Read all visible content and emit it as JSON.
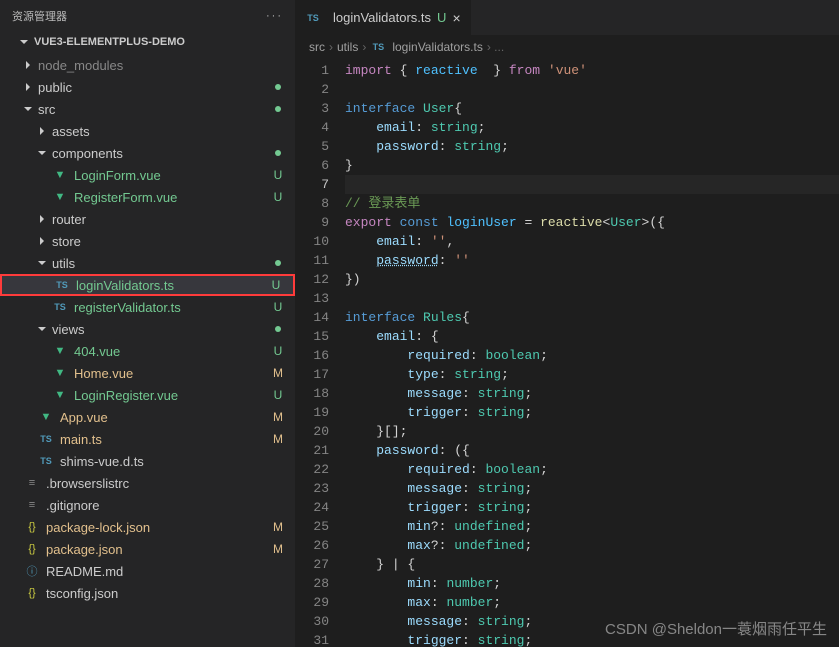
{
  "sidebar": {
    "title": "资源管理器",
    "project": "VUE3-ELEMENTPLUS-DEMO"
  },
  "tree": [
    {
      "name": "node_modules",
      "type": "folder",
      "expanded": false,
      "depth": 0,
      "dim": true
    },
    {
      "name": "public",
      "type": "folder",
      "expanded": false,
      "depth": 0,
      "dot": "U"
    },
    {
      "name": "src",
      "type": "folder",
      "expanded": true,
      "depth": 0,
      "dot": "U"
    },
    {
      "name": "assets",
      "type": "folder",
      "expanded": false,
      "depth": 1
    },
    {
      "name": "components",
      "type": "folder",
      "expanded": true,
      "depth": 1,
      "dot": "U"
    },
    {
      "name": "LoginForm.vue",
      "type": "vue",
      "depth": 2,
      "status": "U",
      "txt": "u"
    },
    {
      "name": "RegisterForm.vue",
      "type": "vue",
      "depth": 2,
      "status": "U",
      "txt": "u"
    },
    {
      "name": "router",
      "type": "folder",
      "expanded": false,
      "depth": 1
    },
    {
      "name": "store",
      "type": "folder",
      "expanded": false,
      "depth": 1
    },
    {
      "name": "utils",
      "type": "folder",
      "expanded": true,
      "depth": 1,
      "dot": "U"
    },
    {
      "name": "loginValidators.ts",
      "type": "ts",
      "depth": 2,
      "status": "U",
      "txt": "u",
      "selected": true,
      "highlighted": true
    },
    {
      "name": "registerValidator.ts",
      "type": "ts",
      "depth": 2,
      "status": "U",
      "txt": "u"
    },
    {
      "name": "views",
      "type": "folder",
      "expanded": true,
      "depth": 1,
      "dot": "U"
    },
    {
      "name": "404.vue",
      "type": "vue",
      "depth": 2,
      "status": "U",
      "txt": "u"
    },
    {
      "name": "Home.vue",
      "type": "vue",
      "depth": 2,
      "status": "M",
      "txt": "m"
    },
    {
      "name": "LoginRegister.vue",
      "type": "vue",
      "depth": 2,
      "status": "U",
      "txt": "u"
    },
    {
      "name": "App.vue",
      "type": "vue",
      "depth": 1,
      "status": "M",
      "txt": "m"
    },
    {
      "name": "main.ts",
      "type": "ts",
      "depth": 1,
      "status": "M",
      "txt": "m"
    },
    {
      "name": "shims-vue.d.ts",
      "type": "ts",
      "depth": 1
    },
    {
      "name": ".browserslistrc",
      "type": "conf",
      "depth": 0
    },
    {
      "name": ".gitignore",
      "type": "conf",
      "depth": 0
    },
    {
      "name": "package-lock.json",
      "type": "json",
      "depth": 0,
      "status": "M",
      "txt": "m"
    },
    {
      "name": "package.json",
      "type": "json",
      "depth": 0,
      "status": "M",
      "txt": "m"
    },
    {
      "name": "README.md",
      "type": "info",
      "depth": 0
    },
    {
      "name": "tsconfig.json",
      "type": "json",
      "depth": 0
    }
  ],
  "tab": {
    "filename": "loginValidators.ts",
    "status": "U"
  },
  "breadcrumbs": [
    "src",
    "utils",
    "loginValidators.ts"
  ],
  "code_lines": [
    [
      [
        "kw",
        "import"
      ],
      [
        "punc",
        " { "
      ],
      [
        "var",
        "reactive"
      ],
      [
        "punc",
        "  } "
      ],
      [
        "kw",
        "from"
      ],
      [
        "punc",
        " "
      ],
      [
        "str",
        "'vue'"
      ]
    ],
    [],
    [
      [
        "storage",
        "interface"
      ],
      [
        "punc",
        " "
      ],
      [
        "type",
        "User"
      ],
      [
        "punc",
        "{"
      ]
    ],
    [
      [
        "indent",
        "    "
      ],
      [
        "prop",
        "email"
      ],
      [
        "punc",
        ": "
      ],
      [
        "type",
        "string"
      ],
      [
        "punc",
        ";"
      ]
    ],
    [
      [
        "indent",
        "    "
      ],
      [
        "prop",
        "password"
      ],
      [
        "punc",
        ": "
      ],
      [
        "type",
        "string"
      ],
      [
        "punc",
        ";"
      ]
    ],
    [
      [
        "punc",
        "}"
      ]
    ],
    [],
    [
      [
        "comment",
        "// 登录表单"
      ]
    ],
    [
      [
        "kw",
        "export"
      ],
      [
        "punc",
        " "
      ],
      [
        "storage",
        "const"
      ],
      [
        "punc",
        " "
      ],
      [
        "var",
        "loginUser"
      ],
      [
        "punc",
        " = "
      ],
      [
        "func",
        "reactive"
      ],
      [
        "punc",
        "<"
      ],
      [
        "type",
        "User"
      ],
      [
        "punc",
        ">({"
      ]
    ],
    [
      [
        "indent",
        "    "
      ],
      [
        "prop",
        "email"
      ],
      [
        "punc",
        ": "
      ],
      [
        "str",
        "''"
      ],
      [
        "punc",
        ","
      ]
    ],
    [
      [
        "indent",
        "    "
      ],
      [
        "prop underline",
        "password"
      ],
      [
        "punc",
        ": "
      ],
      [
        "str",
        "''"
      ]
    ],
    [
      [
        "punc",
        "})"
      ]
    ],
    [],
    [
      [
        "storage",
        "interface"
      ],
      [
        "punc",
        " "
      ],
      [
        "type",
        "Rules"
      ],
      [
        "punc",
        "{"
      ]
    ],
    [
      [
        "indent",
        "    "
      ],
      [
        "prop",
        "email"
      ],
      [
        "punc",
        ": {"
      ]
    ],
    [
      [
        "indent",
        "        "
      ],
      [
        "prop",
        "required"
      ],
      [
        "punc",
        ": "
      ],
      [
        "type",
        "boolean"
      ],
      [
        "punc",
        ";"
      ]
    ],
    [
      [
        "indent",
        "        "
      ],
      [
        "prop",
        "type"
      ],
      [
        "punc",
        ": "
      ],
      [
        "type",
        "string"
      ],
      [
        "punc",
        ";"
      ]
    ],
    [
      [
        "indent",
        "        "
      ],
      [
        "prop",
        "message"
      ],
      [
        "punc",
        ": "
      ],
      [
        "type",
        "string"
      ],
      [
        "punc",
        ";"
      ]
    ],
    [
      [
        "indent",
        "        "
      ],
      [
        "prop",
        "trigger"
      ],
      [
        "punc",
        ": "
      ],
      [
        "type",
        "string"
      ],
      [
        "punc",
        ";"
      ]
    ],
    [
      [
        "indent",
        "    "
      ],
      [
        "punc",
        "}[];"
      ]
    ],
    [
      [
        "indent",
        "    "
      ],
      [
        "prop",
        "password"
      ],
      [
        "punc",
        ": ({"
      ]
    ],
    [
      [
        "indent",
        "        "
      ],
      [
        "prop",
        "required"
      ],
      [
        "punc",
        ": "
      ],
      [
        "type",
        "boolean"
      ],
      [
        "punc",
        ";"
      ]
    ],
    [
      [
        "indent",
        "        "
      ],
      [
        "prop",
        "message"
      ],
      [
        "punc",
        ": "
      ],
      [
        "type",
        "string"
      ],
      [
        "punc",
        ";"
      ]
    ],
    [
      [
        "indent",
        "        "
      ],
      [
        "prop",
        "trigger"
      ],
      [
        "punc",
        ": "
      ],
      [
        "type",
        "string"
      ],
      [
        "punc",
        ";"
      ]
    ],
    [
      [
        "indent",
        "        "
      ],
      [
        "prop",
        "min"
      ],
      [
        "punc",
        "?: "
      ],
      [
        "type",
        "undefined"
      ],
      [
        "punc",
        ";"
      ]
    ],
    [
      [
        "indent",
        "        "
      ],
      [
        "prop",
        "max"
      ],
      [
        "punc",
        "?: "
      ],
      [
        "type",
        "undefined"
      ],
      [
        "punc",
        ";"
      ]
    ],
    [
      [
        "indent",
        "    "
      ],
      [
        "punc",
        "} | {"
      ]
    ],
    [
      [
        "indent",
        "        "
      ],
      [
        "prop",
        "min"
      ],
      [
        "punc",
        ": "
      ],
      [
        "type",
        "number"
      ],
      [
        "punc",
        ";"
      ]
    ],
    [
      [
        "indent",
        "        "
      ],
      [
        "prop",
        "max"
      ],
      [
        "punc",
        ": "
      ],
      [
        "type",
        "number"
      ],
      [
        "punc",
        ";"
      ]
    ],
    [
      [
        "indent",
        "        "
      ],
      [
        "prop",
        "message"
      ],
      [
        "punc",
        ": "
      ],
      [
        "type",
        "string"
      ],
      [
        "punc",
        ";"
      ]
    ],
    [
      [
        "indent",
        "        "
      ],
      [
        "prop",
        "trigger"
      ],
      [
        "punc",
        ": "
      ],
      [
        "type",
        "string"
      ],
      [
        "punc",
        ";"
      ]
    ]
  ],
  "active_line": 7,
  "watermark": "CSDN @Sheldon一蓑烟雨任平生"
}
